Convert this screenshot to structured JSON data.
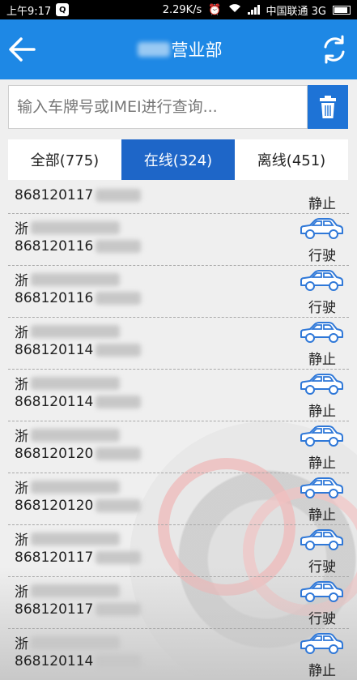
{
  "status_bar": {
    "time": "上午9:17",
    "net_speed": "2.29K/s",
    "carrier": "中国联通 3G"
  },
  "header": {
    "title": "营业部"
  },
  "search": {
    "placeholder": "输入车牌号或IMEI进行查询..."
  },
  "tabs": [
    {
      "label": "全部(775)",
      "active": false
    },
    {
      "label": "在线(324)",
      "active": true
    },
    {
      "label": "离线(451)",
      "active": false
    }
  ],
  "vehicles": [
    {
      "plate": "",
      "imei": "868120117",
      "state": "静止"
    },
    {
      "plate": "浙",
      "imei": "868120116",
      "state": "行驶"
    },
    {
      "plate": "浙",
      "imei": "868120116",
      "state": "行驶"
    },
    {
      "plate": "浙",
      "imei": "868120114",
      "state": "静止"
    },
    {
      "plate": "浙",
      "imei": "868120114",
      "state": "静止"
    },
    {
      "plate": "浙",
      "imei": "868120120",
      "state": "静止"
    },
    {
      "plate": "浙",
      "imei": "868120120",
      "state": "静止"
    },
    {
      "plate": "浙",
      "imei": "868120117",
      "state": "行驶"
    },
    {
      "plate": "浙",
      "imei": "868120117",
      "state": "行驶"
    },
    {
      "plate": "浙",
      "imei": "868120114",
      "state": "静止"
    }
  ],
  "colors": {
    "header_bg": "#1e88e5",
    "tab_active_bg": "#1e66c8",
    "car_icon": "#2f78d8"
  },
  "icons": {
    "back": "arrow-left-icon",
    "refresh": "refresh-icon",
    "delete": "trash-icon",
    "vehicle": "car-icon"
  }
}
